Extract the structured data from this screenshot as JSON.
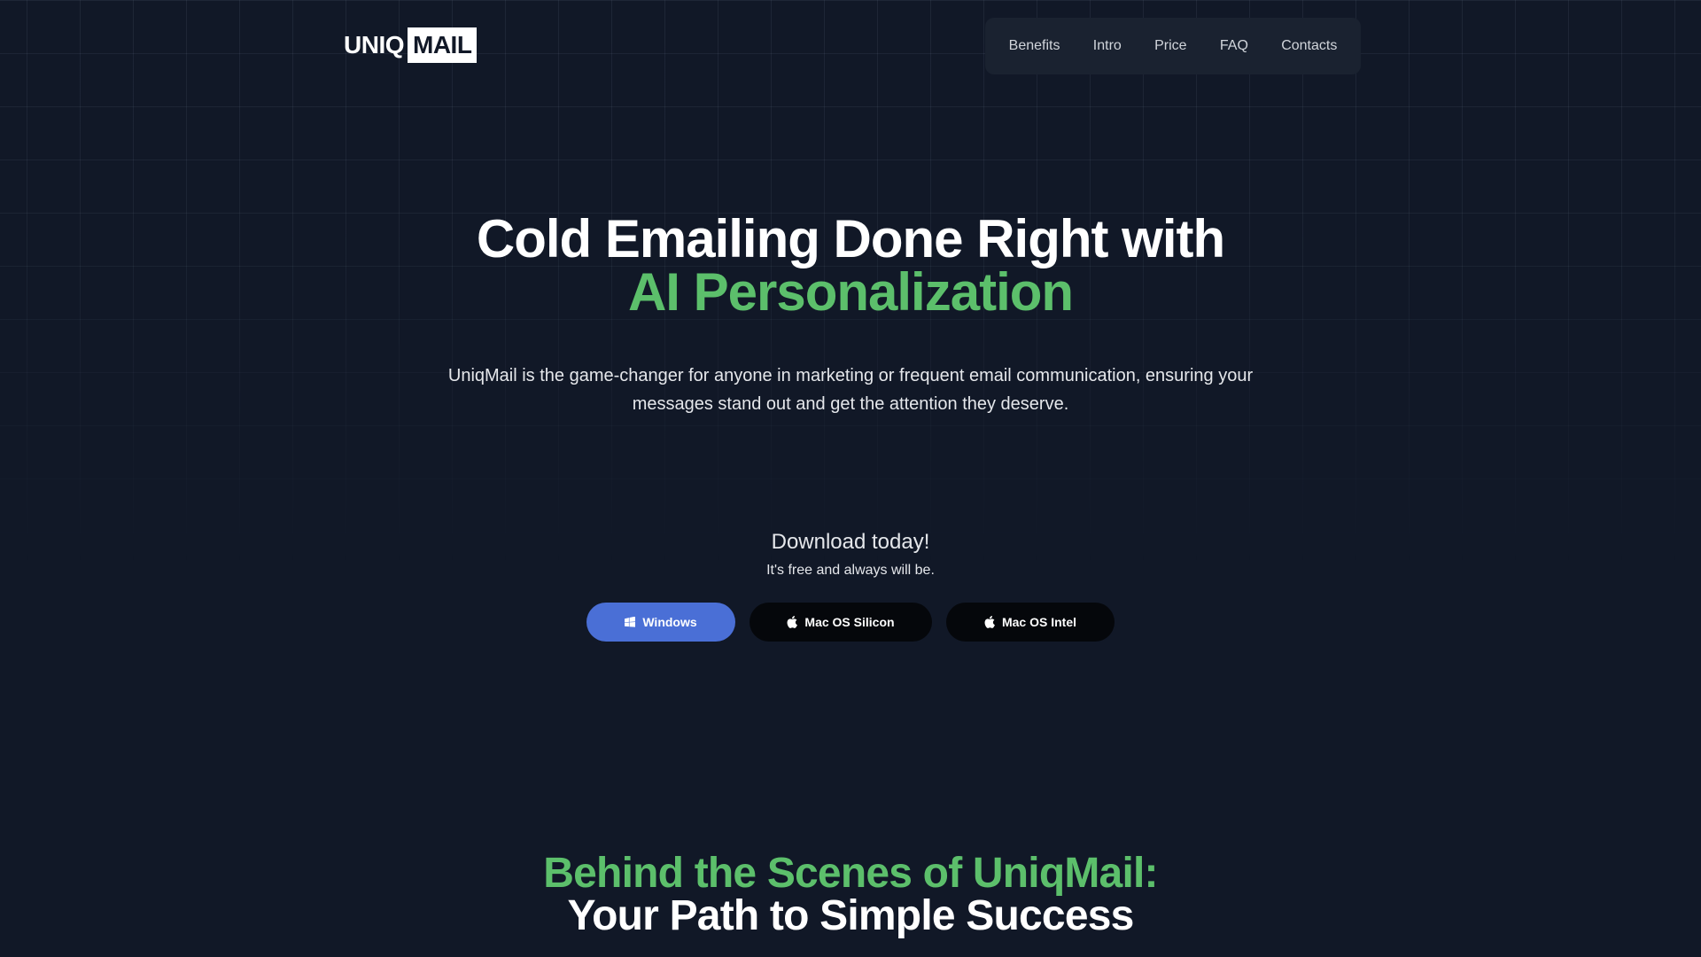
{
  "brand": {
    "logo_part1": "UNIQ",
    "logo_part2": "MAIL"
  },
  "nav": {
    "items": [
      {
        "label": "Benefits"
      },
      {
        "label": "Intro"
      },
      {
        "label": "Price"
      },
      {
        "label": "FAQ"
      },
      {
        "label": "Contacts"
      }
    ]
  },
  "hero": {
    "title_line1": "Cold Emailing Done Right with",
    "title_line2": "AI Personalization",
    "description": "UniqMail is the game-changer for anyone in marketing or frequent email communication, ensuring your messages stand out and get the attention they deserve."
  },
  "download": {
    "title": "Download today!",
    "subtitle": "It's free and always will be.",
    "buttons": [
      {
        "label": "Windows",
        "icon": "windows-icon"
      },
      {
        "label": "Mac OS Silicon",
        "icon": "apple-icon"
      },
      {
        "label": "Mac OS Intel",
        "icon": "apple-icon"
      }
    ]
  },
  "section2": {
    "title_line1": "Behind the Scenes of UniqMail:",
    "title_line2": "Your Path to Simple Success"
  },
  "colors": {
    "background": "#111827",
    "accent_green": "#5cbf6b",
    "windows_button": "#4a6fd6",
    "mac_button": "#05070b",
    "nav_background": "#1a2230"
  }
}
